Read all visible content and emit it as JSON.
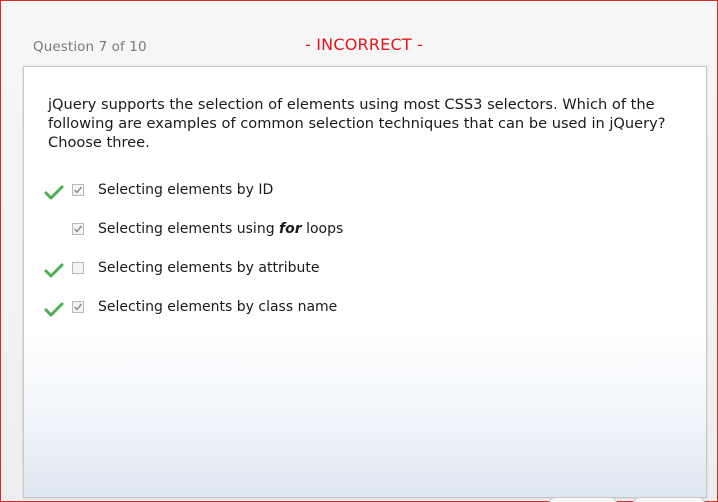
{
  "header": {
    "question_counter": "Question 7 of 10",
    "result_status": "- INCORRECT -"
  },
  "question": {
    "text": "jQuery supports the selection of elements using most CSS3 selectors. Which of the following are examples of common selection techniques that can be used in jQuery? Choose three."
  },
  "options": [
    {
      "prefix": "Selecting elements by ID",
      "emphasis": "",
      "suffix": "",
      "checked": true,
      "correct": true
    },
    {
      "prefix": "Selecting elements using ",
      "emphasis": "for",
      "suffix": " loops",
      "checked": true,
      "correct": false
    },
    {
      "prefix": "Selecting elements by attribute",
      "emphasis": "",
      "suffix": "",
      "checked": false,
      "correct": true
    },
    {
      "prefix": "Selecting elements by class name",
      "emphasis": "",
      "suffix": "",
      "checked": true,
      "correct": true
    }
  ],
  "colors": {
    "frame_border": "#d62b2b",
    "status_text": "#e3161b",
    "correct_check": "#4caf50",
    "checkbox_tick": "#8a8a8a"
  }
}
